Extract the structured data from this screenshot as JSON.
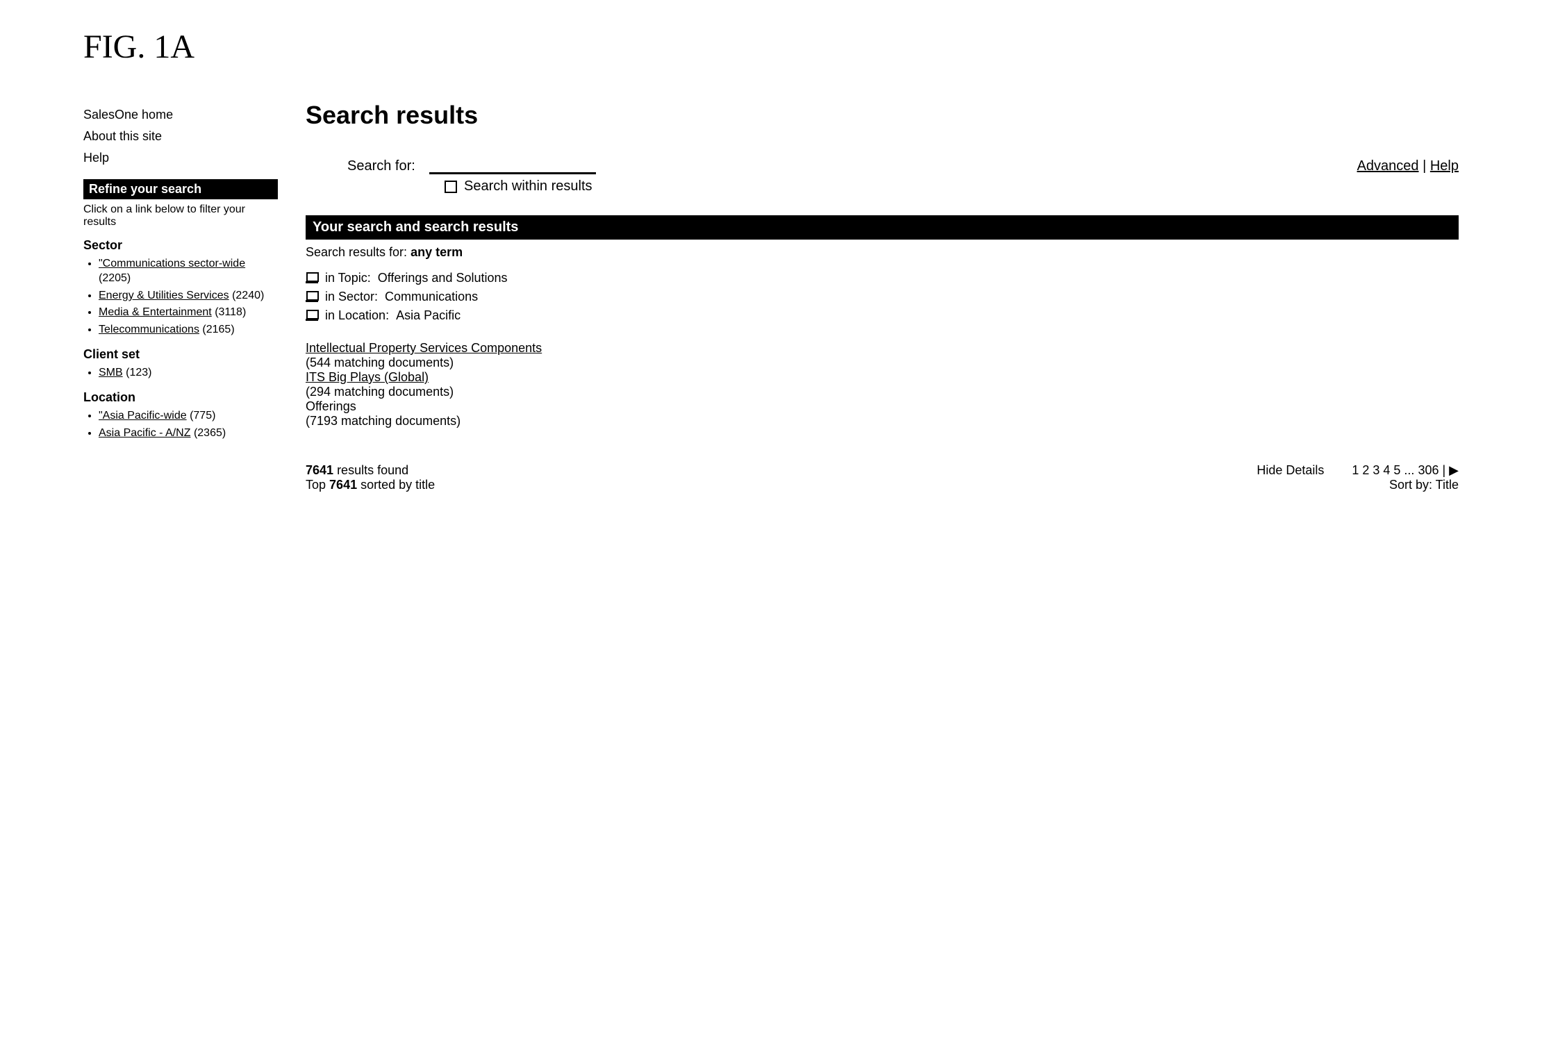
{
  "fig_label": "FIG. 1A",
  "sidebar": {
    "nav": [
      "SalesOne home",
      "About this site",
      "Help"
    ],
    "refine_header": "Refine your search",
    "refine_hint": "Click on a link below to filter your results",
    "facets": [
      {
        "title": "Sector",
        "items": [
          {
            "link": "\"Communications sector-wide",
            "count": "(2205)"
          },
          {
            "link": "Energy & Utilities Services",
            "count": "(2240)"
          },
          {
            "link": "Media & Entertainment",
            "count": "(3118)"
          },
          {
            "link": "Telecommunications",
            "count": "(2165)"
          }
        ]
      },
      {
        "title": "Client set",
        "items": [
          {
            "link": "SMB",
            "count": "(123)"
          }
        ]
      },
      {
        "title": "Location",
        "items": [
          {
            "link": "\"Asia Pacific-wide",
            "count": "(775)"
          },
          {
            "link": "Asia Pacific - A/NZ",
            "count": "(2365)"
          }
        ]
      }
    ]
  },
  "main": {
    "title": "Search results",
    "search_label": "Search for:",
    "search_value": "",
    "advanced_label": "Advanced",
    "help_label": "Help",
    "within_label": "Search within results",
    "black_bar": "Your search and search results",
    "results_for_prefix": "Search results for:",
    "results_for_term": "any term",
    "crumbs": [
      {
        "prefix": "in Topic:",
        "value": "Offerings and Solutions"
      },
      {
        "prefix": "in Sector:",
        "value": "Communications"
      },
      {
        "prefix": "in Location:",
        "value": "Asia Pacific"
      }
    ],
    "related": [
      {
        "title": "Intellectual Property Services Components",
        "count": "(544 matching documents)"
      },
      {
        "title": "ITS Big Plays (Global)",
        "count": "(294 matching documents)"
      },
      {
        "title_plain": "Offerings",
        "count": "(7193 matching documents)"
      }
    ],
    "found_line_a": "7641",
    "found_line_b": "results found",
    "sorted_prefix": "Top",
    "sorted_count": "7641",
    "sorted_suffix": "sorted by title",
    "hide_details": "Hide Details",
    "pager": "1 2 3 4 5 ... 306 | ▶",
    "sort_by": "Sort by: Title"
  }
}
